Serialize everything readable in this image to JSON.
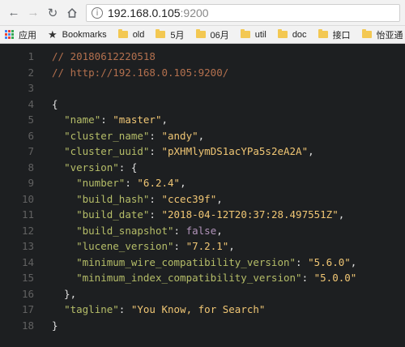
{
  "browser": {
    "url_host": "192.168.0.105",
    "url_port": ":9200",
    "bookmarks": [
      "应用",
      "Bookmarks",
      "old",
      "5月",
      "06月",
      "util",
      "doc",
      "接口",
      "怡亚通"
    ]
  },
  "editor": {
    "lines": [
      [
        {
          "t": "// 20180612220518",
          "c": "comment"
        }
      ],
      [
        {
          "t": "// http://192.168.0.105:9200/",
          "c": "comment"
        }
      ],
      [],
      [
        {
          "t": "{",
          "c": "punc"
        }
      ],
      [
        {
          "t": "  "
        },
        {
          "t": "\"name\"",
          "c": "key"
        },
        {
          "t": ": "
        },
        {
          "t": "\"master\"",
          "c": "str"
        },
        {
          "t": ","
        }
      ],
      [
        {
          "t": "  "
        },
        {
          "t": "\"cluster_name\"",
          "c": "key"
        },
        {
          "t": ": "
        },
        {
          "t": "\"andy\"",
          "c": "str"
        },
        {
          "t": ","
        }
      ],
      [
        {
          "t": "  "
        },
        {
          "t": "\"cluster_uuid\"",
          "c": "key"
        },
        {
          "t": ": "
        },
        {
          "t": "\"pXHMlymDS1acYPa5s2eA2A\"",
          "c": "str"
        },
        {
          "t": ","
        }
      ],
      [
        {
          "t": "  "
        },
        {
          "t": "\"version\"",
          "c": "key"
        },
        {
          "t": ": {"
        }
      ],
      [
        {
          "t": "    "
        },
        {
          "t": "\"number\"",
          "c": "key"
        },
        {
          "t": ": "
        },
        {
          "t": "\"6.2.4\"",
          "c": "str"
        },
        {
          "t": ","
        }
      ],
      [
        {
          "t": "    "
        },
        {
          "t": "\"build_hash\"",
          "c": "key"
        },
        {
          "t": ": "
        },
        {
          "t": "\"ccec39f\"",
          "c": "str"
        },
        {
          "t": ","
        }
      ],
      [
        {
          "t": "    "
        },
        {
          "t": "\"build_date\"",
          "c": "key"
        },
        {
          "t": ": "
        },
        {
          "t": "\"2018-04-12T20:37:28.497551Z\"",
          "c": "str"
        },
        {
          "t": ","
        }
      ],
      [
        {
          "t": "    "
        },
        {
          "t": "\"build_snapshot\"",
          "c": "key"
        },
        {
          "t": ": "
        },
        {
          "t": "false",
          "c": "bool"
        },
        {
          "t": ","
        }
      ],
      [
        {
          "t": "    "
        },
        {
          "t": "\"lucene_version\"",
          "c": "key"
        },
        {
          "t": ": "
        },
        {
          "t": "\"7.2.1\"",
          "c": "str"
        },
        {
          "t": ","
        }
      ],
      [
        {
          "t": "    "
        },
        {
          "t": "\"minimum_wire_compatibility_version\"",
          "c": "key"
        },
        {
          "t": ": "
        },
        {
          "t": "\"5.6.0\"",
          "c": "str"
        },
        {
          "t": ","
        }
      ],
      [
        {
          "t": "    "
        },
        {
          "t": "\"minimum_index_compatibility_version\"",
          "c": "key"
        },
        {
          "t": ": "
        },
        {
          "t": "\"5.0.0\"",
          "c": "str"
        }
      ],
      [
        {
          "t": "  },"
        }
      ],
      [
        {
          "t": "  "
        },
        {
          "t": "\"tagline\"",
          "c": "key"
        },
        {
          "t": ": "
        },
        {
          "t": "\"You Know, for Search\"",
          "c": "str"
        }
      ],
      [
        {
          "t": "}",
          "c": "punc"
        }
      ]
    ]
  }
}
